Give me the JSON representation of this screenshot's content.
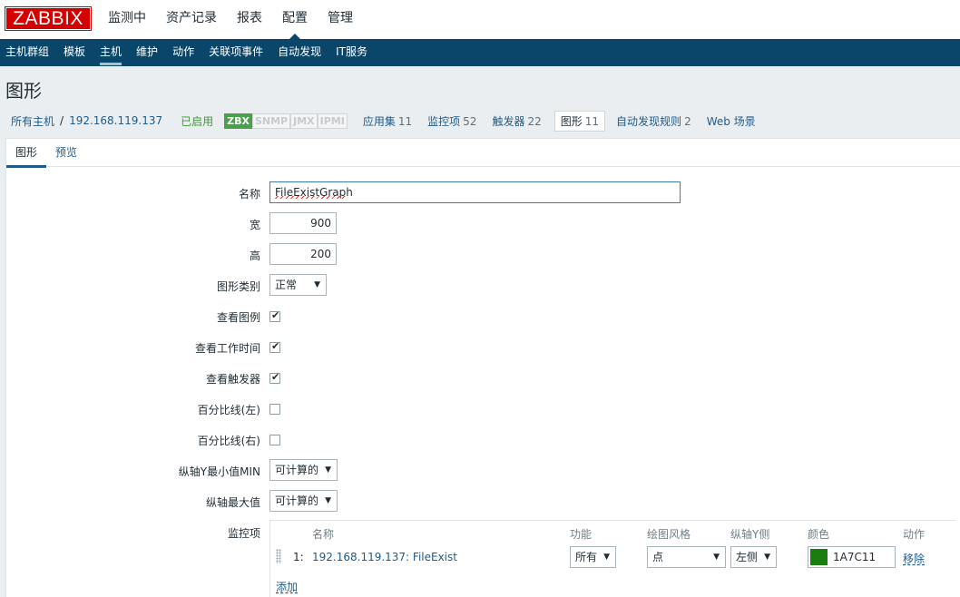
{
  "brand": {
    "logo_text": "ZABBIX",
    "accent": "#d40000",
    "nav_bg": "#0a466a"
  },
  "topnav": [
    {
      "label": "监测中"
    },
    {
      "label": "资产记录"
    },
    {
      "label": "报表"
    },
    {
      "label": "配置",
      "active": true
    },
    {
      "label": "管理"
    }
  ],
  "subnav": [
    {
      "label": "主机群组"
    },
    {
      "label": "模板"
    },
    {
      "label": "主机",
      "active": true
    },
    {
      "label": "维护"
    },
    {
      "label": "动作"
    },
    {
      "label": "关联项事件"
    },
    {
      "label": "自动发现"
    },
    {
      "label": "IT服务"
    }
  ],
  "page_title": "图形",
  "host_nav": {
    "all_hosts": "所有主机",
    "separator": "/",
    "host": "192.168.119.137",
    "status": "已启用",
    "availability": [
      "ZBX",
      "SNMP",
      "JMX",
      "IPMI"
    ],
    "items": [
      {
        "label": "应用集",
        "count": "11"
      },
      {
        "label": "监控项",
        "count": "52"
      },
      {
        "label": "触发器",
        "count": "22"
      },
      {
        "label": "图形",
        "count": "11"
      },
      {
        "label": "自动发现规则",
        "count": "2"
      },
      {
        "label": "Web 场景",
        "count": ""
      }
    ]
  },
  "tabs": [
    {
      "label": "图形",
      "active": true
    },
    {
      "label": "预览"
    }
  ],
  "form": {
    "name_label": "名称",
    "name_value": "FileExistGraph",
    "width_label": "宽",
    "width_value": "900",
    "height_label": "高",
    "height_value": "200",
    "graph_type_label": "图形类别",
    "graph_type_value": "正常",
    "show_legend_label": "查看图例",
    "show_legend": true,
    "show_worktime_label": "查看工作时间",
    "show_worktime": true,
    "show_triggers_label": "查看触发器",
    "show_triggers": true,
    "percentile_left_label": "百分比线(左)",
    "percentile_left": false,
    "percentile_right_label": "百分比线(右)",
    "percentile_right": false,
    "ymin_label": "纵轴Y最小值MIN",
    "ymin_value": "可计算的",
    "ymax_label": "纵轴最大值",
    "ymax_value": "可计算的",
    "items_label": "监控项"
  },
  "items_table": {
    "headers": {
      "name": "名称",
      "function": "功能",
      "draw_style": "绘图风格",
      "y_axis_side": "纵轴Y侧",
      "color": "颜色",
      "action": "动作"
    },
    "rows": [
      {
        "index": "1:",
        "name": "192.168.119.137: FileExist",
        "function": "所有",
        "draw_style": "点",
        "y_axis_side": "左侧",
        "color": "1A7C11",
        "color_hex": "#1A7C11",
        "action": "移除"
      }
    ],
    "add_label": "添加"
  }
}
